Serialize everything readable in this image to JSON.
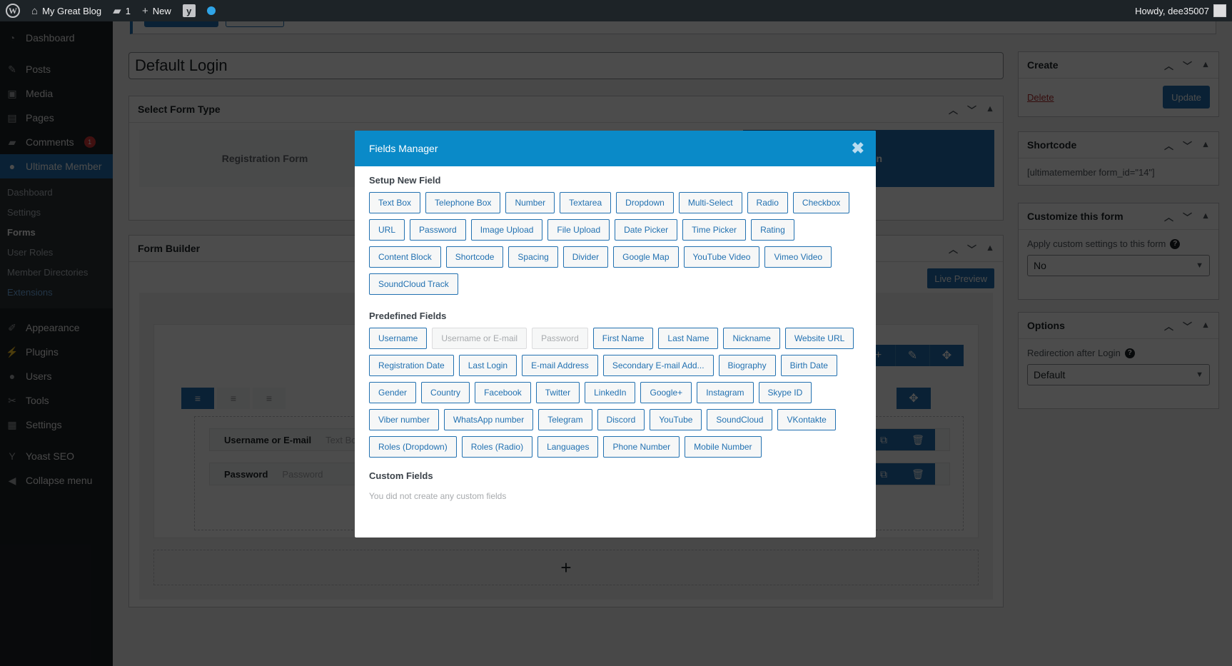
{
  "adminbar": {
    "site_name": "My Great Blog",
    "comments_count": "1",
    "new_label": "New",
    "howdy": "Howdy, dee35007"
  },
  "sidebar": {
    "items_top": [
      {
        "label": "Dashboard",
        "icon": "dashboard-icon",
        "glyph": "◔"
      }
    ],
    "items_mid": [
      {
        "label": "Posts",
        "icon": "pin-icon",
        "glyph": "✎"
      },
      {
        "label": "Media",
        "icon": "media-icon",
        "glyph": "▣"
      },
      {
        "label": "Pages",
        "icon": "pages-icon",
        "glyph": "▤"
      },
      {
        "label": "Comments",
        "icon": "comment-icon",
        "glyph": "▰",
        "badge": "1"
      },
      {
        "label": "Ultimate Member",
        "icon": "user-icon",
        "glyph": "●",
        "active": true
      }
    ],
    "submenu": [
      {
        "label": "Dashboard"
      },
      {
        "label": "Settings"
      },
      {
        "label": "Forms",
        "current": true
      },
      {
        "label": "User Roles"
      },
      {
        "label": "Member Directories"
      },
      {
        "label": "Extensions",
        "highlight": true
      }
    ],
    "items_bottom": [
      {
        "label": "Appearance",
        "icon": "brush-icon",
        "glyph": "✐"
      },
      {
        "label": "Plugins",
        "icon": "plug-icon",
        "glyph": "⚡"
      },
      {
        "label": "Users",
        "icon": "users-icon",
        "glyph": "●"
      },
      {
        "label": "Tools",
        "icon": "wrench-icon",
        "glyph": "✂"
      },
      {
        "label": "Settings",
        "icon": "settings-icon",
        "glyph": "▦"
      }
    ],
    "yoast": {
      "label": "Yoast SEO",
      "glyph": "Y"
    },
    "collapse": {
      "label": "Collapse menu",
      "glyph": "◀"
    }
  },
  "main": {
    "form_title": "Default Login",
    "form_type": {
      "title": "Select Form Type",
      "options": [
        "Registration Form",
        "Login"
      ]
    },
    "builder": {
      "title": "Form Builder",
      "live_preview": "Live Preview",
      "fields": [
        {
          "label": "Username or E-mail",
          "type": "Text Box"
        },
        {
          "label": "Password",
          "type": "Password"
        }
      ]
    }
  },
  "right": {
    "create": {
      "title": "Create",
      "delete": "Delete",
      "update": "Update"
    },
    "shortcode": {
      "title": "Shortcode",
      "value": "[ultimatemember form_id=\"14\"]"
    },
    "customize": {
      "title": "Customize this form",
      "label": "Apply custom settings to this form",
      "value": "No"
    },
    "options": {
      "title": "Options",
      "label": "Redirection after Login",
      "value": "Default"
    }
  },
  "modal": {
    "title": "Fields Manager",
    "setup_title": "Setup New Field",
    "setup_fields": [
      "Text Box",
      "Telephone Box",
      "Number",
      "Textarea",
      "Dropdown",
      "Multi-Select",
      "Radio",
      "Checkbox",
      "URL",
      "Password",
      "Image Upload",
      "File Upload",
      "Date Picker",
      "Time Picker",
      "Rating",
      "Content Block",
      "Shortcode",
      "Spacing",
      "Divider",
      "Google Map",
      "YouTube Video",
      "Vimeo Video",
      "SoundCloud Track"
    ],
    "predefined_title": "Predefined Fields",
    "predefined_fields": [
      {
        "label": "Username"
      },
      {
        "label": "Username or E-mail",
        "disabled": true
      },
      {
        "label": "Password",
        "disabled": true
      },
      {
        "label": "First Name"
      },
      {
        "label": "Last Name"
      },
      {
        "label": "Nickname"
      },
      {
        "label": "Website URL"
      },
      {
        "label": "Registration Date"
      },
      {
        "label": "Last Login"
      },
      {
        "label": "E-mail Address"
      },
      {
        "label": "Secondary E-mail Add..."
      },
      {
        "label": "Biography"
      },
      {
        "label": "Birth Date"
      },
      {
        "label": "Gender"
      },
      {
        "label": "Country"
      },
      {
        "label": "Facebook"
      },
      {
        "label": "Twitter"
      },
      {
        "label": "LinkedIn"
      },
      {
        "label": "Google+"
      },
      {
        "label": "Instagram"
      },
      {
        "label": "Skype ID"
      },
      {
        "label": "Viber number"
      },
      {
        "label": "WhatsApp number"
      },
      {
        "label": "Telegram"
      },
      {
        "label": "Discord"
      },
      {
        "label": "YouTube"
      },
      {
        "label": "SoundCloud"
      },
      {
        "label": "VKontakte"
      },
      {
        "label": "Roles (Dropdown)"
      },
      {
        "label": "Roles (Radio)"
      },
      {
        "label": "Languages"
      },
      {
        "label": "Phone Number"
      },
      {
        "label": "Mobile Number"
      }
    ],
    "custom_title": "Custom Fields",
    "custom_empty": "You did not create any custom fields"
  },
  "colors": {
    "modal_header": "#0a8ac8",
    "accent": "#2271b1",
    "admin_dark": "#1d2327"
  }
}
